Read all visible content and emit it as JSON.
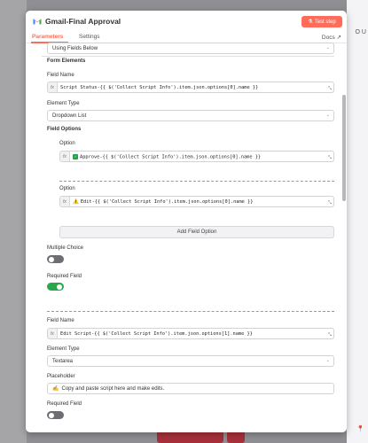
{
  "modal": {
    "title": "Gmail-Final Approval",
    "test_button_label": "Test step",
    "tabs": [
      "Parameters",
      "Settings"
    ],
    "docs_label": "Docs"
  },
  "form": {
    "using_fields_value": "Using Fields Below",
    "form_elements_label": "Form Elements",
    "field1": {
      "field_name_label": "Field Name",
      "field_name_expr": "Script Status-{{ $('Collect Script Info').item.json.options[0].name }}",
      "element_type_label": "Element Type",
      "element_type_value": "Dropdown List",
      "field_options_label": "Field Options",
      "option_label": "Option",
      "option1_emoji": "✓",
      "option1_expr": "Approve-{{ $('Collect Script Info').item.json.options[0].name }}",
      "option2_emoji": "⚠️",
      "option2_expr": "Edit-{{ $('Collect Script Info').item.json.options[0].name }}",
      "add_field_option_label": "Add Field Option",
      "multiple_choice_label": "Multiple Choice",
      "multiple_choice_on": false,
      "required_label": "Required Field",
      "required_on": true
    },
    "field2": {
      "field_name_label": "Field Name",
      "field_name_expr": "Edit Script-{{ $('Collect Script Info').item.json.options[1].name }}",
      "element_type_label": "Element Type",
      "element_type_value": "Textarea",
      "placeholder_label": "Placeholder",
      "placeholder_emoji": "✍️",
      "placeholder_value": "Copy and paste script here and make edits.",
      "required_label": "Required Field",
      "required_on": false
    }
  },
  "background": {
    "right_text": "O U",
    "accent": "#ff6d5a",
    "toggle_on_color": "#29a84b"
  }
}
